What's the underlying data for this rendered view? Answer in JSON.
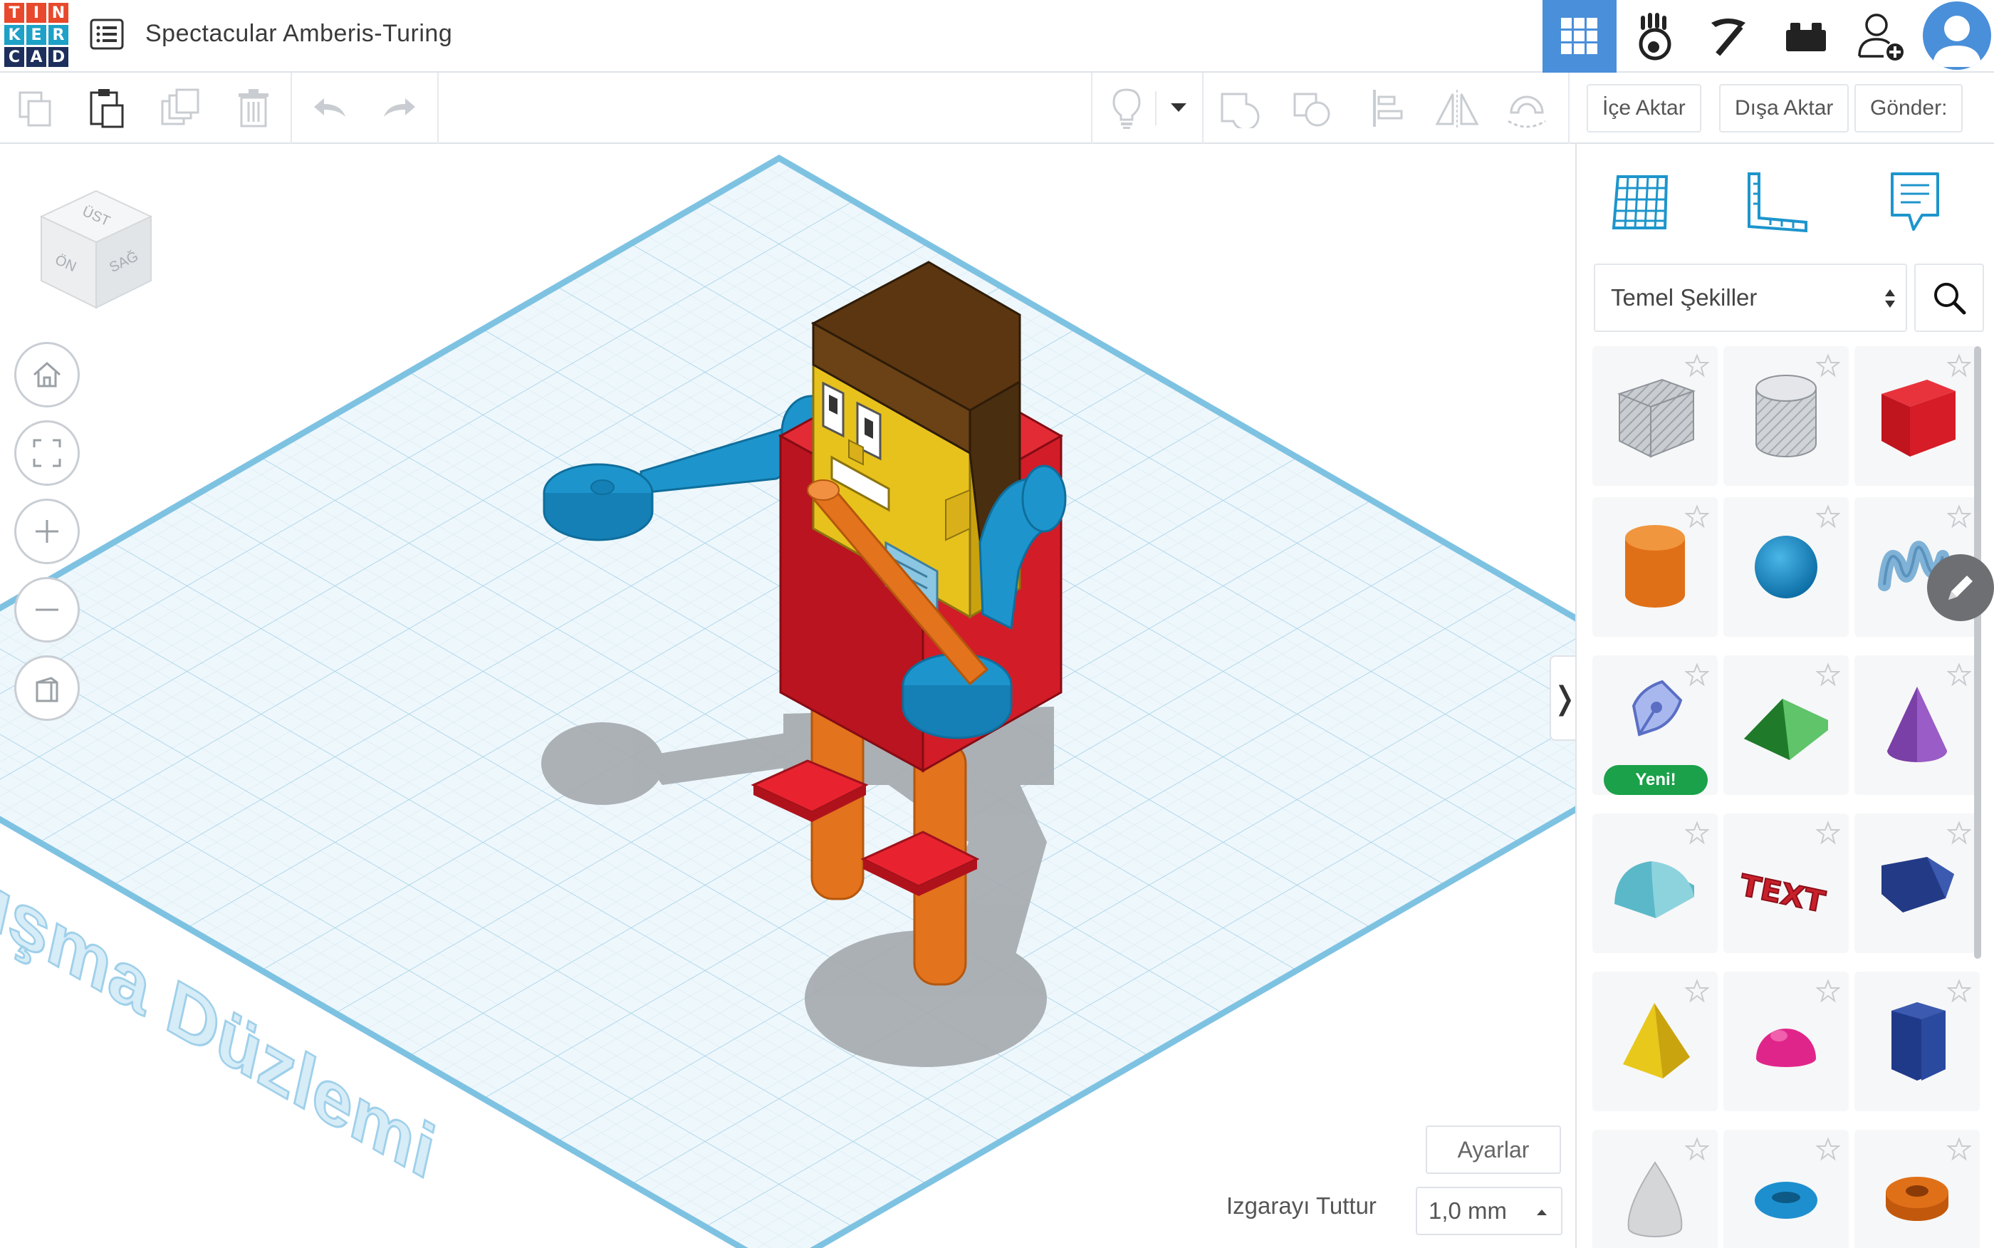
{
  "app": {
    "logo_letters": [
      "T",
      "I",
      "N",
      "K",
      "E",
      "R",
      "C",
      "A",
      "D"
    ],
    "logo_colors": [
      "#e8492c",
      "#e8492c",
      "#e8492c",
      "#1da1c7",
      "#1da1c7",
      "#1da1c7",
      "#1d2f5c",
      "#1d2f5c",
      "#1d2f5c"
    ],
    "design_title": "Spectacular Amberis-Turing",
    "accent_color": "#4a8fd9"
  },
  "header": {
    "buttons": [
      {
        "name": "3d-design-view-button",
        "icon": "grid-icon",
        "active": true
      },
      {
        "name": "blocks-button",
        "icon": "paw-icon",
        "active": false
      },
      {
        "name": "bricks-button",
        "icon": "pickaxe-icon",
        "active": false
      },
      {
        "name": "lego-button",
        "icon": "brick-icon",
        "active": false
      },
      {
        "name": "invite-user-button",
        "icon": "user-plus-icon",
        "active": false
      }
    ],
    "avatar_icon": "user-avatar-icon"
  },
  "toolbar": {
    "tools": [
      "copy-icon",
      "paste-icon",
      "duplicate-icon",
      "delete-icon",
      "undo-icon",
      "redo-icon",
      "lightbulb-icon",
      "dropdown-caret-icon",
      "group-icon",
      "ungroup-icon",
      "align-icon",
      "mirror-icon",
      "magnet-icon"
    ],
    "import_label": "İçe Aktar",
    "export_label": "Dışa Aktar",
    "send_label": "Gönder:"
  },
  "workspace": {
    "view_cube": {
      "top_label": "ÜST",
      "front_label": "ÖN",
      "right_label": "SAĞ"
    },
    "workplane_label": "Çalışma Düzlemi",
    "nav_buttons": [
      "home-icon",
      "fit-view-icon",
      "zoom-in-icon",
      "zoom-out-icon",
      "ortho-view-icon"
    ],
    "settings_label": "Ayarlar",
    "snap_grid_label": "Izgarayı Tuttur",
    "snap_grid_value": "1,0 mm"
  },
  "panel": {
    "tabs": [
      "workplane-grid-icon",
      "ruler-icon",
      "notes-icon"
    ],
    "category_value": "Temel Şekiller",
    "new_badge": "Yeni!",
    "shapes": [
      {
        "name": "box-hole",
        "color": "#b9bcc2"
      },
      {
        "name": "cylinder-hole",
        "color": "#c4c7cc"
      },
      {
        "name": "box",
        "color": "#d91a25"
      },
      {
        "name": "cylinder",
        "color": "#e07018"
      },
      {
        "name": "sphere",
        "color": "#1d8fcf"
      },
      {
        "name": "scribble",
        "color": "#7fb2d6"
      },
      {
        "name": "shape-generator",
        "color": "#7f9de0"
      },
      {
        "name": "roof",
        "color": "#2e9e3a"
      },
      {
        "name": "cone",
        "color": "#7b3fa8"
      },
      {
        "name": "round-roof",
        "color": "#5bb8c8"
      },
      {
        "name": "text",
        "color": "#c8202b"
      },
      {
        "name": "wedge",
        "color": "#233a86"
      },
      {
        "name": "pyramid",
        "color": "#e8c81a"
      },
      {
        "name": "half-sphere",
        "color": "#e0258a"
      },
      {
        "name": "polygon",
        "color": "#203a8a"
      },
      {
        "name": "paraboloid",
        "color": "#d4d6d8"
      },
      {
        "name": "torus",
        "color": "#1d8fcf"
      },
      {
        "name": "tube",
        "color": "#e07018"
      }
    ],
    "text_shape_label": "TEXT"
  }
}
